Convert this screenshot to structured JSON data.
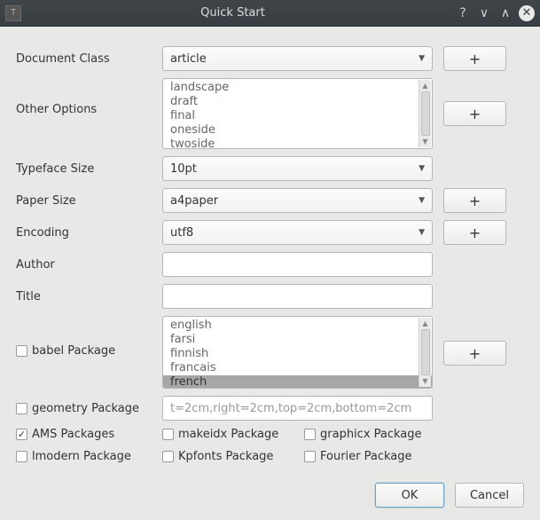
{
  "title": "Quick Start",
  "plus": "+",
  "labels": {
    "document_class": "Document Class",
    "other_options": "Other Options",
    "typeface_size": "Typeface Size",
    "paper_size": "Paper Size",
    "encoding": "Encoding",
    "author": "Author",
    "title_label": "Title",
    "babel": "babel Package",
    "geometry": "geometry Package",
    "ams": "AMS Packages",
    "makeidx": "makeidx Package",
    "graphicx": "graphicx Package",
    "lmodern": "lmodern Package",
    "kpfonts": "Kpfonts Package",
    "fourier": "Fourier Package"
  },
  "values": {
    "document_class": "article",
    "typeface_size": "10pt",
    "paper_size": "a4paper",
    "encoding": "utf8",
    "author": "",
    "title": "",
    "geometry_text": "t=2cm,right=2cm,top=2cm,bottom=2cm"
  },
  "other_options": [
    "landscape",
    "draft",
    "final",
    "oneside",
    "twoside"
  ],
  "babel_langs": [
    "english",
    "farsi",
    "finnish",
    "francais",
    "french"
  ],
  "babel_selected": "french",
  "checked": {
    "babel": false,
    "geometry": false,
    "ams": true,
    "makeidx": false,
    "graphicx": false,
    "lmodern": false,
    "kpfonts": false,
    "fourier": false
  },
  "buttons": {
    "ok": "OK",
    "cancel": "Cancel"
  }
}
